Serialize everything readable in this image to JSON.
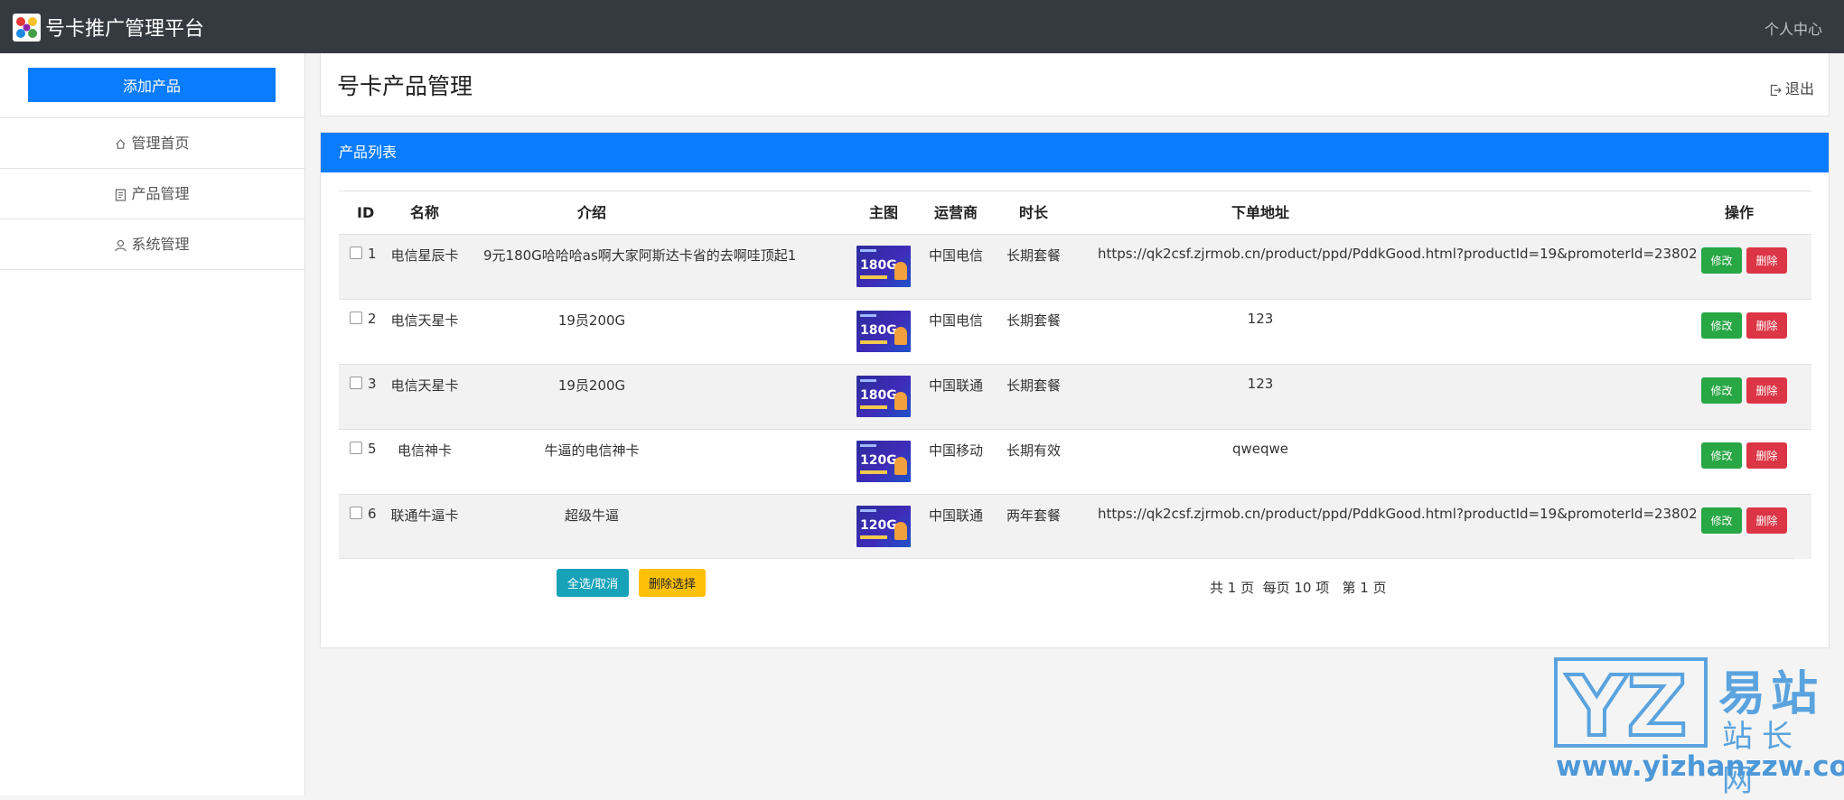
{
  "app": {
    "title": "号卡推广管理平台",
    "user_menu": "个人中心"
  },
  "sidebar": {
    "add_button": "添加产品",
    "items": [
      {
        "label": "管理首页",
        "icon": "home-icon"
      },
      {
        "label": "产品管理",
        "icon": "document-icon"
      },
      {
        "label": "系统管理",
        "icon": "user-icon"
      }
    ]
  },
  "header": {
    "page_title": "号卡产品管理",
    "logout": "退出"
  },
  "product_list": {
    "card_title": "产品列表",
    "columns": [
      "ID",
      "名称",
      "介绍",
      "主图",
      "运营商",
      "时长",
      "下单地址",
      "操作"
    ],
    "rows": [
      {
        "id": "1",
        "name": "电信星辰卡",
        "intro": "9元180G哈哈哈as啊大家阿斯达卡省的去啊哇顶起1",
        "thumb_text": "180G",
        "carrier": "中国电信",
        "duration": "长期套餐",
        "order_url": "https://qk2csf.zjrmob.cn/product/ppd/PddkGood.html?productId=19&promoterId=23802",
        "edit": "修改",
        "delete": "删除"
      },
      {
        "id": "2",
        "name": "电信天星卡",
        "intro": "19员200G",
        "thumb_text": "180G",
        "carrier": "中国电信",
        "duration": "长期套餐",
        "order_url": "123",
        "edit": "修改",
        "delete": "删除"
      },
      {
        "id": "3",
        "name": "电信天星卡",
        "intro": "19员200G",
        "thumb_text": "180G",
        "carrier": "中国联通",
        "duration": "长期套餐",
        "order_url": "123",
        "edit": "修改",
        "delete": "删除"
      },
      {
        "id": "5",
        "name": "电信神卡",
        "intro": "牛逼的电信神卡",
        "thumb_text": "120G",
        "carrier": "中国移动",
        "duration": "长期有效",
        "order_url": "qweqwe",
        "edit": "修改",
        "delete": "删除"
      },
      {
        "id": "6",
        "name": "联通牛逼卡",
        "intro": "超级牛逼",
        "thumb_text": "120G",
        "carrier": "中国联通",
        "duration": "两年套餐",
        "order_url": "https://qk2csf.zjrmob.cn/product/ppd/PddkGood.html?productId=19&promoterId=23802",
        "edit": "修改",
        "delete": "删除"
      }
    ],
    "select_all": "全选/取消",
    "delete_selected": "删除选择",
    "pager": "共 1 页  每页 10 项   第 1 页"
  },
  "watermark": {
    "logo_letters": "YZ",
    "title": "易站",
    "subtitle": "站长网",
    "url": "www.yizhanzzw.com"
  },
  "colors": {
    "topbar": "#343a40",
    "primary": "#0a7cff",
    "edit": "#28a745",
    "delete": "#dc3545",
    "select_all": "#17a2b8",
    "delete_selected": "#ffc107",
    "watermark": "#5aa3de"
  }
}
